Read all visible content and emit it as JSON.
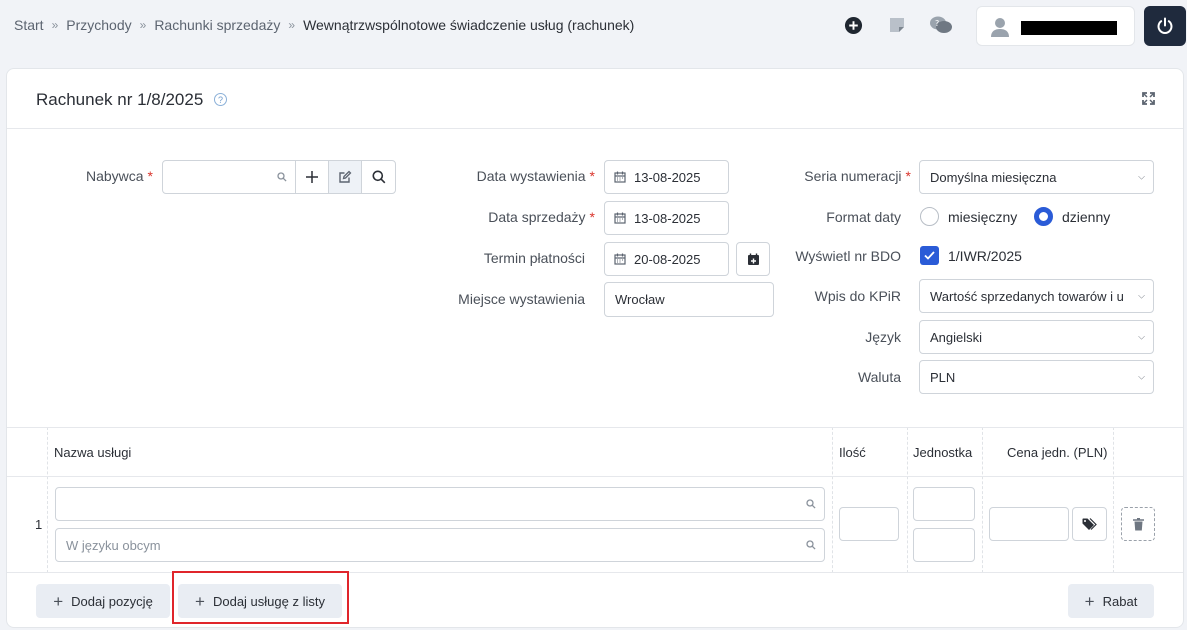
{
  "breadcrumb": [
    "Start",
    "Przychody",
    "Rachunki sprzedaży",
    "Wewnątrzwspólnotowe świadczenie usług (rachunek)"
  ],
  "header": {
    "icons": [
      "add-circle-icon",
      "note-icon",
      "chat-icon",
      "user-icon",
      "power-icon"
    ],
    "user_name_redacted": true
  },
  "card": {
    "title": "Rachunek nr 1/8/2025"
  },
  "form": {
    "buyer": {
      "label": "Nabywca",
      "required": true,
      "value": ""
    },
    "issue_date": {
      "label": "Data wystawienia",
      "required": true,
      "value": "13-08-2025"
    },
    "sale_date": {
      "label": "Data sprzedaży",
      "required": true,
      "value": "13-08-2025"
    },
    "payment_term": {
      "label": "Termin płatności",
      "value": "20-08-2025"
    },
    "place": {
      "label": "Miejsce wystawienia",
      "value": "Wrocław"
    },
    "numbering": {
      "label": "Seria numeracji",
      "required": true,
      "value": "Domyślna miesięczna"
    },
    "date_format": {
      "label": "Format daty",
      "options": [
        "miesięczny",
        "dzienny"
      ],
      "selected": "dzienny"
    },
    "bdo": {
      "label": "Wyświetl nr BDO",
      "checked": true,
      "value": "1/IWR/2025"
    },
    "kpir": {
      "label": "Wpis do KPiR",
      "value": "Wartość sprzedanych towarów i usług"
    },
    "language": {
      "label": "Język",
      "value": "Angielski"
    },
    "currency": {
      "label": "Waluta",
      "value": "PLN"
    }
  },
  "table": {
    "columns": [
      "Nazwa usługi",
      "Ilość",
      "Jednostka",
      "Cena jedn. (PLN)"
    ],
    "rows": [
      {
        "num": "1",
        "name": "",
        "foreign_placeholder": "W języku obcym"
      }
    ]
  },
  "footer": {
    "add_position": "Dodaj pozycję",
    "add_from_list": "Dodaj usługę z listy",
    "discount": "Rabat"
  },
  "colors": {
    "accent": "#2a5bd7",
    "highlight": "#e0252b",
    "required": "#d9342b",
    "dark": "#1f2a3d"
  }
}
